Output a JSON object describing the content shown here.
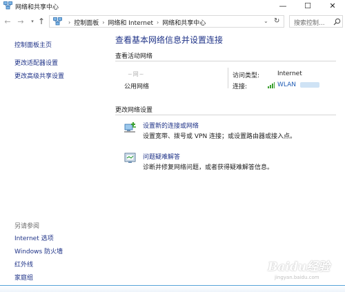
{
  "window": {
    "title": "网络和共享中心",
    "minimize_glyph": "—",
    "maximize_glyph": "☐",
    "close_glyph": "✕"
  },
  "nav": {
    "back_glyph": "←",
    "forward_glyph": "→",
    "recent_glyph": "▾",
    "up_glyph": "↑",
    "breadcrumb": [
      "控制面板",
      "网络和 Internet",
      "网络和共享中心"
    ],
    "separator": "›",
    "dropdown_glyph": "⌄",
    "refresh_glyph": "↻",
    "search_placeholder": "搜索控制..."
  },
  "sidebar": {
    "top_links": [
      "控制面板主页",
      "更改适配器设置",
      "更改高级共享设置"
    ],
    "see_also_heading": "另请参阅",
    "see_also_links": [
      "Internet 选项",
      "Windows 防火墙",
      "红外线",
      "家庭组"
    ]
  },
  "main": {
    "heading": "查看基本网络信息并设置连接",
    "active_section_title": "查看活动网络",
    "network_name_blurred": "~网~",
    "network_type": "公用网络",
    "access_type_label": "访问类型:",
    "access_type_value": "Internet",
    "connection_label": "连接:",
    "connection_value": "WLAN",
    "change_section_title": "更改网络设置",
    "tasks": [
      {
        "link": "设置新的连接或网络",
        "desc": "设置宽带、拨号或 VPN 连接；或设置路由器或接入点。",
        "icon": "new-connection-icon"
      },
      {
        "link": "问题疑难解答",
        "desc": "诊断并修复网络问题，或者获得疑难解答信息。",
        "icon": "troubleshoot-icon"
      }
    ]
  },
  "watermark": {
    "brand": "Baidu经验",
    "site": "jingyan.baidu.com"
  },
  "colors": {
    "link": "#1e3287",
    "accent_line": "#55a3d8",
    "signal": "#3aa02e"
  }
}
